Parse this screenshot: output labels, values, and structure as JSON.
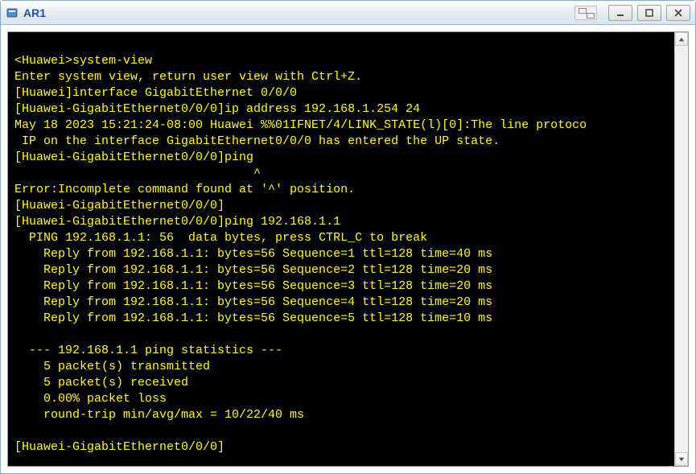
{
  "window": {
    "title": "AR1"
  },
  "terminal": {
    "lines": [
      "",
      "<Huawei>system-view",
      "Enter system view, return user view with Ctrl+Z.",
      "[Huawei]interface GigabitEthernet 0/0/0",
      "[Huawei-GigabitEthernet0/0/0]ip address 192.168.1.254 24",
      "May 18 2023 15:21:24-08:00 Huawei %%01IFNET/4/LINK_STATE(l)[0]:The line protoco",
      " IP on the interface GigabitEthernet0/0/0 has entered the UP state.",
      "[Huawei-GigabitEthernet0/0/0]ping",
      "                                 ^",
      "Error:Incomplete command found at '^' position.",
      "[Huawei-GigabitEthernet0/0/0]",
      "[Huawei-GigabitEthernet0/0/0]ping 192.168.1.1",
      "  PING 192.168.1.1: 56  data bytes, press CTRL_C to break",
      "    Reply from 192.168.1.1: bytes=56 Sequence=1 ttl=128 time=40 ms",
      "    Reply from 192.168.1.1: bytes=56 Sequence=2 ttl=128 time=20 ms",
      "    Reply from 192.168.1.1: bytes=56 Sequence=3 ttl=128 time=20 ms",
      "    Reply from 192.168.1.1: bytes=56 Sequence=4 ttl=128 time=20 ms",
      "    Reply from 192.168.1.1: bytes=56 Sequence=5 ttl=128 time=10 ms",
      "",
      "  --- 192.168.1.1 ping statistics ---",
      "    5 packet(s) transmitted",
      "    5 packet(s) received",
      "    0.00% packet loss",
      "    round-trip min/avg/max = 10/22/40 ms",
      "",
      "[Huawei-GigabitEthernet0/0/0]"
    ]
  }
}
